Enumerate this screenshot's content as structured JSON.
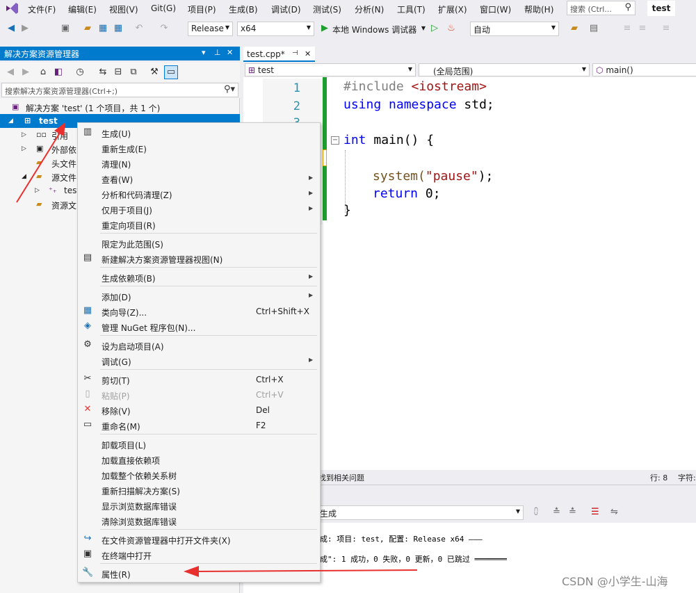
{
  "menubar": {
    "items": [
      "文件(F)",
      "编辑(E)",
      "视图(V)",
      "Git(G)",
      "项目(P)",
      "生成(B)",
      "调试(D)",
      "测试(S)",
      "分析(N)",
      "工具(T)",
      "扩展(X)",
      "窗口(W)",
      "帮助(H)"
    ],
    "search_placeholder": "搜索 (Ctrl...",
    "project_title": "test"
  },
  "toolbar": {
    "config": "Release",
    "platform": "x64",
    "debugger": "本地 Windows 调试器",
    "auto": "自动"
  },
  "solution_explorer": {
    "title": "解决方案资源管理器",
    "search_placeholder": "搜索解决方案资源管理器(Ctrl+;)",
    "solution_label": "解决方案 'test' (1 个项目，共 1 个)",
    "project": "test",
    "nodes": [
      "引用",
      "外部依",
      "头文件",
      "源文件",
      "test",
      "资源文"
    ]
  },
  "editor": {
    "tab_label": "test.cpp*",
    "nav_file": "test",
    "nav_scope": "(全局范围)",
    "nav_func": "main()",
    "line_numbers": [
      "1",
      "2",
      "3"
    ],
    "code": {
      "l1_pp": "#include ",
      "l1_inc": "<iostream>",
      "l2_kw1": "using",
      "l2_kw2": "namespace",
      "l2_rest": " std;",
      "l4_kw": "int",
      "l4_rest": " main() {",
      "l6_fn": "system(",
      "l6_str": "\"pause\"",
      "l6_end": ");",
      "l7_kw": "return",
      "l7_rest": " 0;",
      "l8": "}"
    }
  },
  "statusline": {
    "issues": "找到相关问题",
    "row": "行: 8",
    "col": "字符:"
  },
  "output": {
    "source": "生成",
    "line1": "成: 项目: test, 配置: Release x64 ———",
    "line2": "成\": 1 成功，0 失败，0 更新，0 已跳过 ═══════"
  },
  "context_menu": {
    "items": [
      {
        "icon": "build-icon",
        "label": "生成(U)",
        "shortcut": "",
        "submenu": false,
        "disabled": false
      },
      {
        "icon": "",
        "label": "重新生成(E)",
        "shortcut": "",
        "submenu": false,
        "disabled": false
      },
      {
        "icon": "",
        "label": "清理(N)",
        "shortcut": "",
        "submenu": false,
        "disabled": false
      },
      {
        "icon": "",
        "label": "查看(W)",
        "shortcut": "",
        "submenu": true,
        "disabled": false
      },
      {
        "icon": "",
        "label": "分析和代码清理(Z)",
        "shortcut": "",
        "submenu": true,
        "disabled": false
      },
      {
        "icon": "",
        "label": "仅用于项目(J)",
        "shortcut": "",
        "submenu": true,
        "disabled": false
      },
      {
        "icon": "",
        "label": "重定向项目(R)",
        "shortcut": "",
        "submenu": false,
        "disabled": false
      },
      {
        "sep": true
      },
      {
        "icon": "",
        "label": "限定为此范围(S)",
        "shortcut": "",
        "submenu": false,
        "disabled": false
      },
      {
        "icon": "new-view-icon",
        "label": "新建解决方案资源管理器视图(N)",
        "shortcut": "",
        "submenu": false,
        "disabled": false
      },
      {
        "sep": true
      },
      {
        "icon": "",
        "label": "生成依赖项(B)",
        "shortcut": "",
        "submenu": true,
        "disabled": false
      },
      {
        "sep": true
      },
      {
        "icon": "",
        "label": "添加(D)",
        "shortcut": "",
        "submenu": true,
        "disabled": false
      },
      {
        "icon": "class-wizard-icon",
        "label": "类向导(Z)...",
        "shortcut": "Ctrl+Shift+X",
        "submenu": false,
        "disabled": false
      },
      {
        "icon": "nuget-icon",
        "label": "管理 NuGet 程序包(N)...",
        "shortcut": "",
        "submenu": false,
        "disabled": false
      },
      {
        "sep": true
      },
      {
        "icon": "gear-icon",
        "label": "设为启动项目(A)",
        "shortcut": "",
        "submenu": false,
        "disabled": false
      },
      {
        "icon": "",
        "label": "调试(G)",
        "shortcut": "",
        "submenu": true,
        "disabled": false
      },
      {
        "sep": true
      },
      {
        "icon": "scissors-icon",
        "label": "剪切(T)",
        "shortcut": "Ctrl+X",
        "submenu": false,
        "disabled": false
      },
      {
        "icon": "paste-icon",
        "label": "粘贴(P)",
        "shortcut": "Ctrl+V",
        "submenu": false,
        "disabled": true
      },
      {
        "icon": "remove-icon",
        "label": "移除(V)",
        "shortcut": "Del",
        "submenu": false,
        "disabled": false
      },
      {
        "icon": "rename-icon",
        "label": "重命名(M)",
        "shortcut": "F2",
        "submenu": false,
        "disabled": false
      },
      {
        "sep": true
      },
      {
        "icon": "",
        "label": "卸载项目(L)",
        "shortcut": "",
        "submenu": false,
        "disabled": false
      },
      {
        "icon": "",
        "label": "加载直接依赖项",
        "shortcut": "",
        "submenu": false,
        "disabled": false
      },
      {
        "icon": "",
        "label": "加载整个依赖关系树",
        "shortcut": "",
        "submenu": false,
        "disabled": false
      },
      {
        "icon": "",
        "label": "重新扫描解决方案(S)",
        "shortcut": "",
        "submenu": false,
        "disabled": false
      },
      {
        "icon": "",
        "label": "显示浏览数据库错误",
        "shortcut": "",
        "submenu": false,
        "disabled": false
      },
      {
        "icon": "",
        "label": "清除浏览数据库错误",
        "shortcut": "",
        "submenu": false,
        "disabled": false
      },
      {
        "sep": true
      },
      {
        "icon": "open-folder-icon",
        "label": "在文件资源管理器中打开文件夹(X)",
        "shortcut": "",
        "submenu": false,
        "disabled": false
      },
      {
        "icon": "terminal-icon",
        "label": "在终端中打开",
        "shortcut": "",
        "submenu": false,
        "disabled": false
      },
      {
        "sep": true
      },
      {
        "icon": "wrench-icon",
        "label": "属性(R)",
        "shortcut": "",
        "submenu": false,
        "disabled": false
      }
    ]
  },
  "watermark": "CSDN @小学生-山海",
  "colors": {
    "accent": "#007acc",
    "arrow": "#e8312f",
    "change_bar": "#1e9e2e"
  }
}
